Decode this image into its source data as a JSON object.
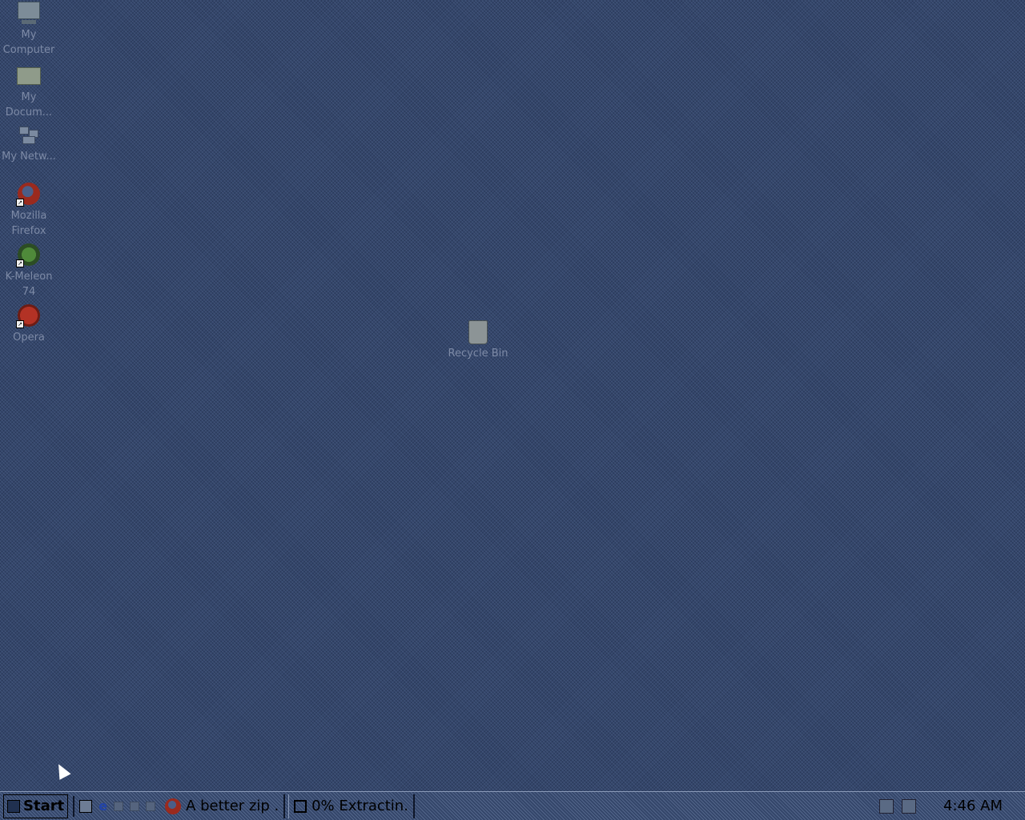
{
  "desktop": {
    "icons": [
      {
        "label": "My Computer",
        "icon": "computer-icon"
      },
      {
        "label": "My Docum...",
        "icon": "folder-icon"
      },
      {
        "label": "My Netw...",
        "icon": "network-icon"
      },
      {
        "label": "Mozilla Firefox",
        "icon": "firefox-icon"
      },
      {
        "label": "K-Meleon 74",
        "icon": "k-meleon-icon"
      },
      {
        "label": "Opera",
        "icon": "opera-icon"
      },
      {
        "label": "Recycle Bin",
        "icon": "recycle-bin-icon"
      }
    ]
  },
  "taskbar": {
    "start_label": "Start",
    "quick_launch": [
      "show-desktop-icon",
      "internet-explorer-icon",
      "quick-launch-icon",
      "quick-launch-icon",
      "quick-launch-icon"
    ],
    "tasks": [
      {
        "label": "A better zip ...",
        "icon": "firefox-icon"
      },
      {
        "label": "0% Extractin...",
        "icon": "window-icon"
      }
    ],
    "tray_icons": [
      "network-tray-icon",
      "volume-tray-icon"
    ],
    "clock": "4:46 AM"
  }
}
